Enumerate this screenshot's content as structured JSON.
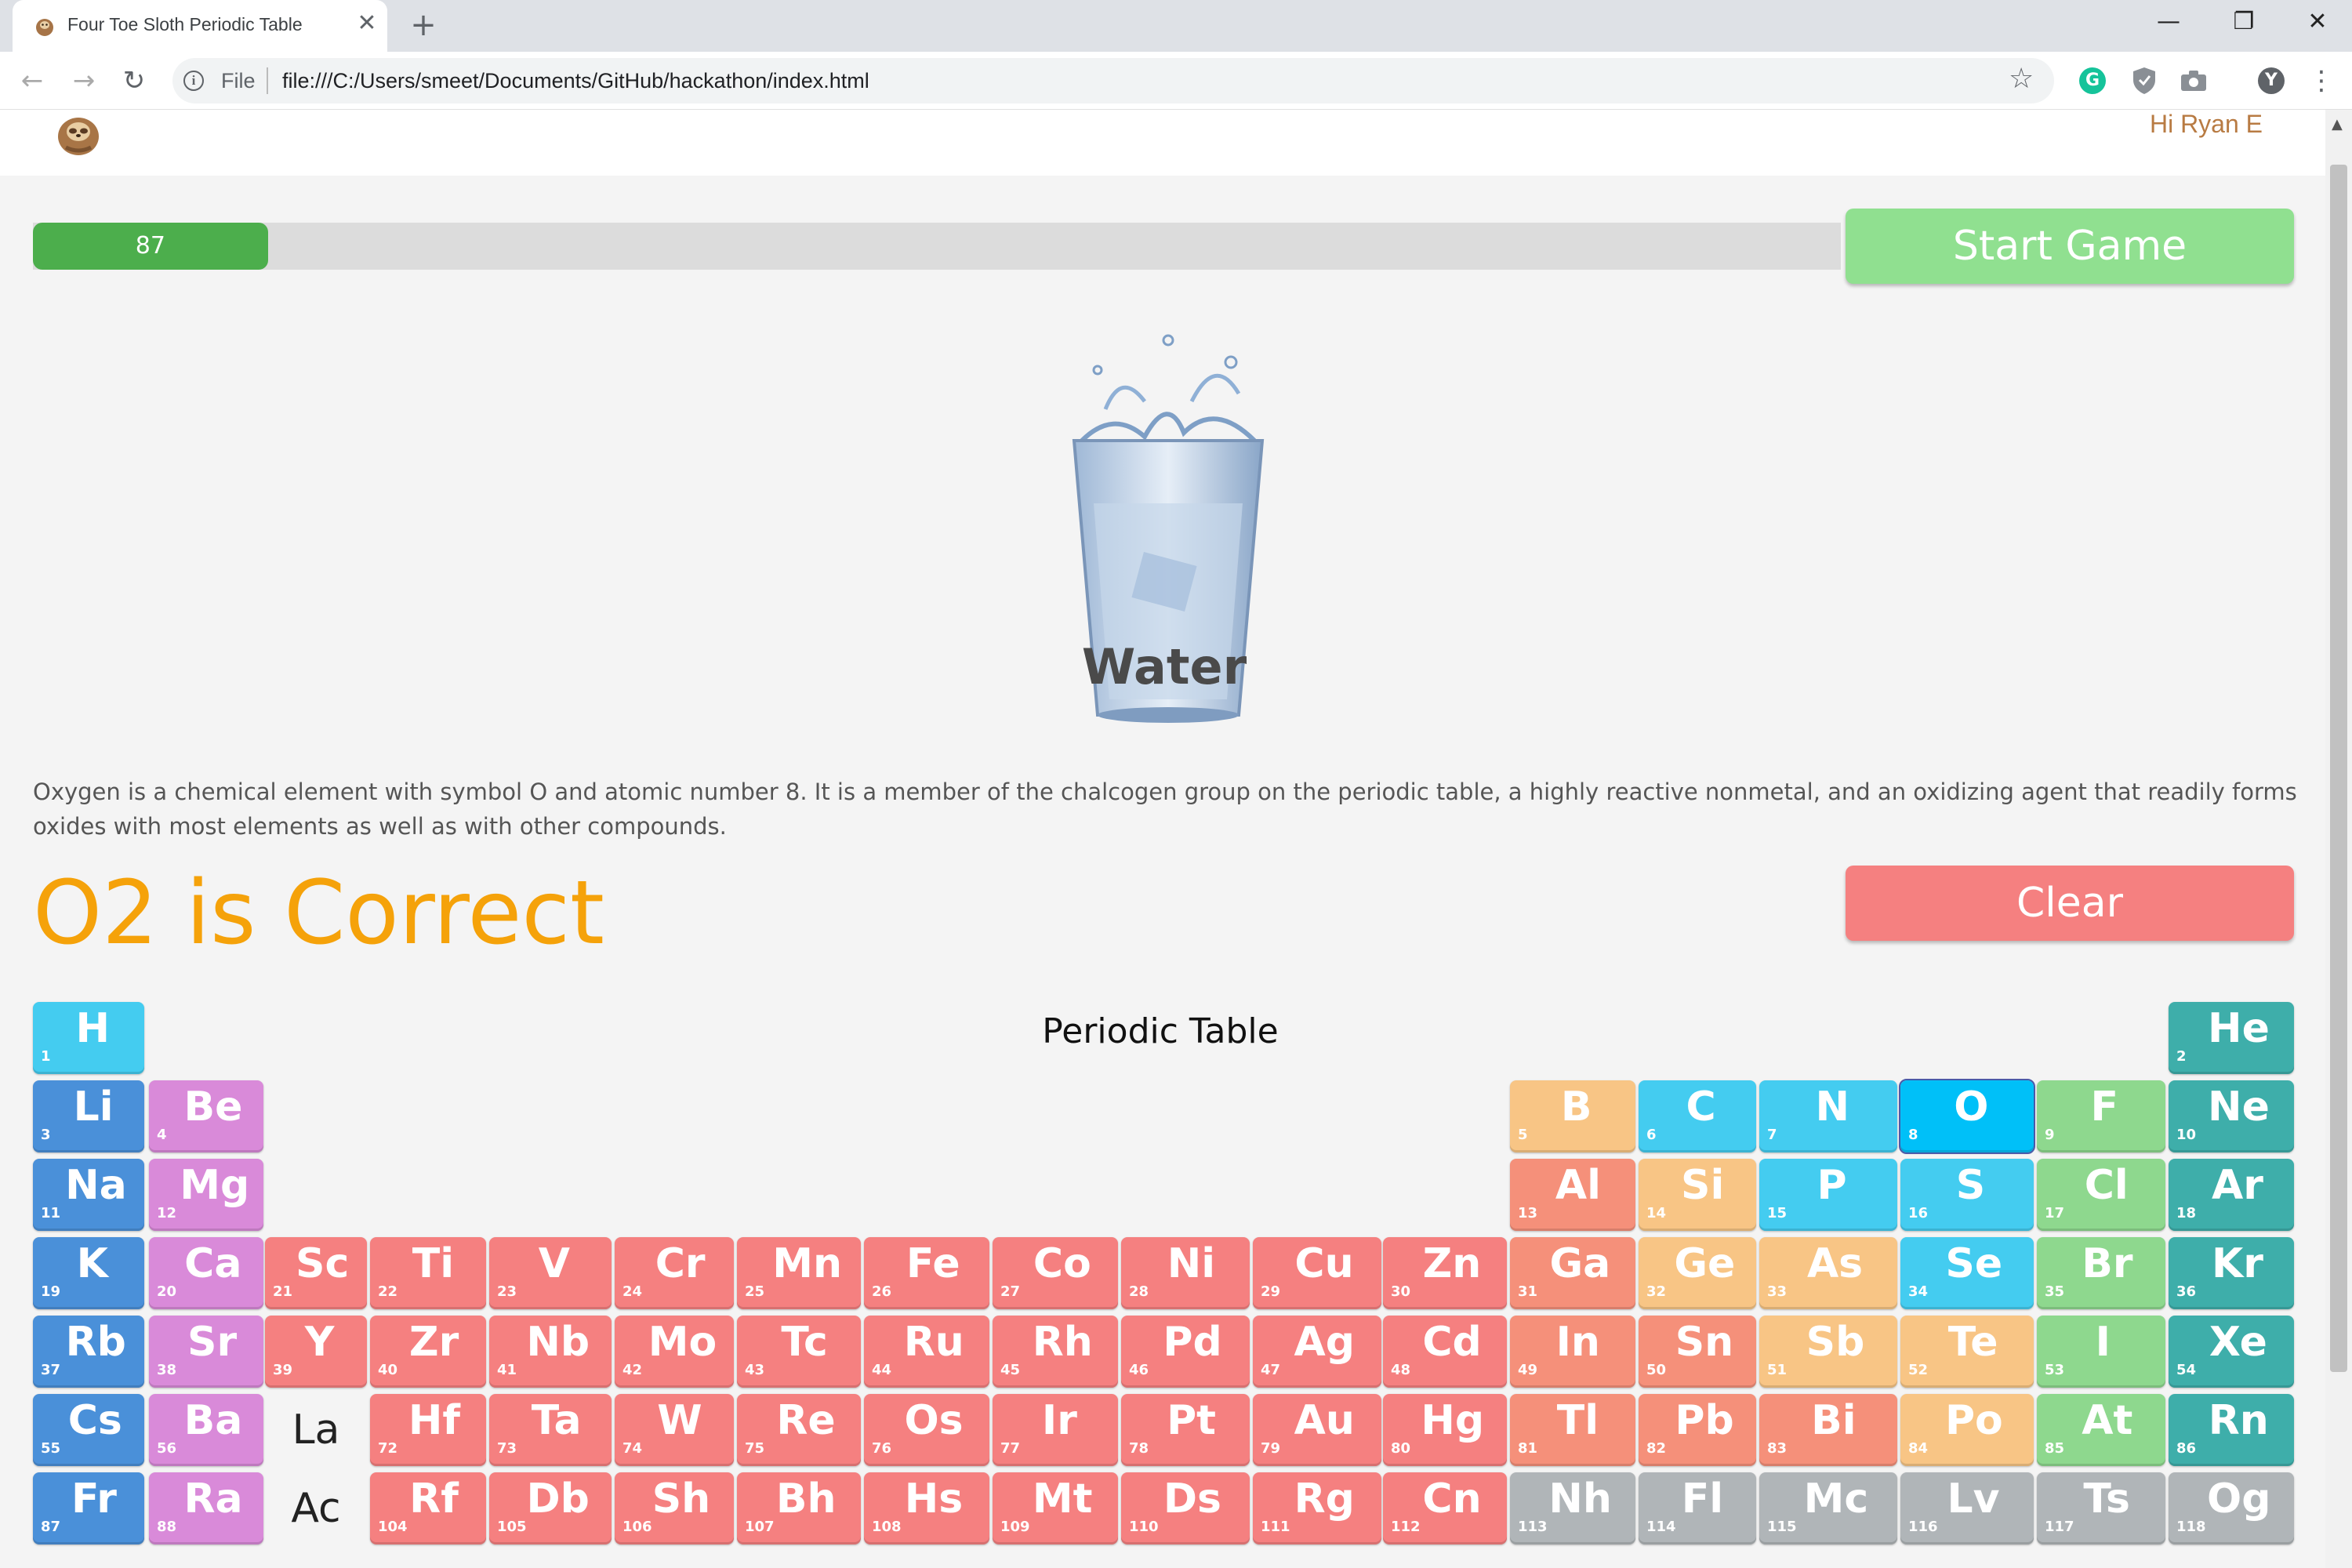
{
  "browser": {
    "tab_title": "Four Toe Sloth Periodic Table",
    "tab_close": "✕",
    "new_tab": "+",
    "minimize": "—",
    "restore": "❐",
    "close": "✕",
    "scheme_label": "File",
    "url": "file:///C:/Users/smeet/Documents/GitHub/hackathon/index.html",
    "back": "←",
    "forward": "→",
    "reload": "↻",
    "star": "☆",
    "menu": "⋮",
    "ext_grammarly": "G",
    "ext_profile": "Y"
  },
  "header": {
    "greeting": "Hi Ryan E"
  },
  "progress": {
    "value": 87,
    "label": "87",
    "fraction": 0.13
  },
  "buttons": {
    "start": "Start Game",
    "clear": "Clear"
  },
  "compound": {
    "name": "Water"
  },
  "description": "Oxygen is a chemical element with symbol O and atomic number 8. It is a member of the chalcogen group on the periodic table, a highly reactive nonmetal, and an oxidizing agent that readily forms oxides with most elements as well as with other compounds.",
  "result": "O2 is Correct",
  "table_title": "Periodic Table",
  "colors": {
    "alkali": "#4a90d9",
    "alkaline": "#d98ad9",
    "transition": "#f58080",
    "post_transition": "#f5907a",
    "metalloid": "#f8c585",
    "nonmetal": "#44ccf0",
    "selected": "#00c0f8",
    "halogen": "#8ed88e",
    "noble": "#3eaeaa",
    "unknown": "#b0b5b8",
    "accent": "#f5a20a"
  },
  "elements": [
    {
      "n": "1",
      "s": "H",
      "r": 0,
      "c": 0,
      "g": "nonmetal"
    },
    {
      "n": "2",
      "s": "He",
      "r": 0,
      "c": 17,
      "g": "noble"
    },
    {
      "n": "3",
      "s": "Li",
      "r": 1,
      "c": 0,
      "g": "alkali"
    },
    {
      "n": "4",
      "s": "Be",
      "r": 1,
      "c": 1,
      "g": "alkaline"
    },
    {
      "n": "5",
      "s": "B",
      "r": 1,
      "c": 12,
      "g": "metalloid"
    },
    {
      "n": "6",
      "s": "C",
      "r": 1,
      "c": 13,
      "g": "nonmetal"
    },
    {
      "n": "7",
      "s": "N",
      "r": 1,
      "c": 14,
      "g": "nonmetal"
    },
    {
      "n": "8",
      "s": "O",
      "r": 1,
      "c": 15,
      "g": "selected",
      "sel": true
    },
    {
      "n": "9",
      "s": "F",
      "r": 1,
      "c": 16,
      "g": "halogen"
    },
    {
      "n": "10",
      "s": "Ne",
      "r": 1,
      "c": 17,
      "g": "noble"
    },
    {
      "n": "11",
      "s": "Na",
      "r": 2,
      "c": 0,
      "g": "alkali"
    },
    {
      "n": "12",
      "s": "Mg",
      "r": 2,
      "c": 1,
      "g": "alkaline"
    },
    {
      "n": "13",
      "s": "Al",
      "r": 2,
      "c": 12,
      "g": "post_transition"
    },
    {
      "n": "14",
      "s": "Si",
      "r": 2,
      "c": 13,
      "g": "metalloid"
    },
    {
      "n": "15",
      "s": "P",
      "r": 2,
      "c": 14,
      "g": "nonmetal"
    },
    {
      "n": "16",
      "s": "S",
      "r": 2,
      "c": 15,
      "g": "nonmetal"
    },
    {
      "n": "17",
      "s": "Cl",
      "r": 2,
      "c": 16,
      "g": "halogen"
    },
    {
      "n": "18",
      "s": "Ar",
      "r": 2,
      "c": 17,
      "g": "noble"
    },
    {
      "n": "19",
      "s": "K",
      "r": 3,
      "c": 0,
      "g": "alkali"
    },
    {
      "n": "20",
      "s": "Ca",
      "r": 3,
      "c": 1,
      "g": "alkaline"
    },
    {
      "n": "21",
      "s": "Sc",
      "r": 3,
      "c": 2,
      "g": "transition"
    },
    {
      "n": "22",
      "s": "Ti",
      "r": 3,
      "c": 3,
      "g": "transition"
    },
    {
      "n": "23",
      "s": "V",
      "r": 3,
      "c": 4,
      "g": "transition"
    },
    {
      "n": "24",
      "s": "Cr",
      "r": 3,
      "c": 5,
      "g": "transition"
    },
    {
      "n": "25",
      "s": "Mn",
      "r": 3,
      "c": 6,
      "g": "transition"
    },
    {
      "n": "26",
      "s": "Fe",
      "r": 3,
      "c": 7,
      "g": "transition"
    },
    {
      "n": "27",
      "s": "Co",
      "r": 3,
      "c": 8,
      "g": "transition"
    },
    {
      "n": "28",
      "s": "Ni",
      "r": 3,
      "c": 9,
      "g": "transition"
    },
    {
      "n": "29",
      "s": "Cu",
      "r": 3,
      "c": 10,
      "g": "transition"
    },
    {
      "n": "30",
      "s": "Zn",
      "r": 3,
      "c": 11,
      "g": "transition"
    },
    {
      "n": "31",
      "s": "Ga",
      "r": 3,
      "c": 12,
      "g": "post_transition"
    },
    {
      "n": "32",
      "s": "Ge",
      "r": 3,
      "c": 13,
      "g": "metalloid"
    },
    {
      "n": "33",
      "s": "As",
      "r": 3,
      "c": 14,
      "g": "metalloid"
    },
    {
      "n": "34",
      "s": "Se",
      "r": 3,
      "c": 15,
      "g": "nonmetal"
    },
    {
      "n": "35",
      "s": "Br",
      "r": 3,
      "c": 16,
      "g": "halogen"
    },
    {
      "n": "36",
      "s": "Kr",
      "r": 3,
      "c": 17,
      "g": "noble"
    },
    {
      "n": "37",
      "s": "Rb",
      "r": 4,
      "c": 0,
      "g": "alkali"
    },
    {
      "n": "38",
      "s": "Sr",
      "r": 4,
      "c": 1,
      "g": "alkaline"
    },
    {
      "n": "39",
      "s": "Y",
      "r": 4,
      "c": 2,
      "g": "transition"
    },
    {
      "n": "40",
      "s": "Zr",
      "r": 4,
      "c": 3,
      "g": "transition"
    },
    {
      "n": "41",
      "s": "Nb",
      "r": 4,
      "c": 4,
      "g": "transition"
    },
    {
      "n": "42",
      "s": "Mo",
      "r": 4,
      "c": 5,
      "g": "transition"
    },
    {
      "n": "43",
      "s": "Tc",
      "r": 4,
      "c": 6,
      "g": "transition"
    },
    {
      "n": "44",
      "s": "Ru",
      "r": 4,
      "c": 7,
      "g": "transition"
    },
    {
      "n": "45",
      "s": "Rh",
      "r": 4,
      "c": 8,
      "g": "transition"
    },
    {
      "n": "46",
      "s": "Pd",
      "r": 4,
      "c": 9,
      "g": "transition"
    },
    {
      "n": "47",
      "s": "Ag",
      "r": 4,
      "c": 10,
      "g": "transition"
    },
    {
      "n": "48",
      "s": "Cd",
      "r": 4,
      "c": 11,
      "g": "transition"
    },
    {
      "n": "49",
      "s": "In",
      "r": 4,
      "c": 12,
      "g": "post_transition"
    },
    {
      "n": "50",
      "s": "Sn",
      "r": 4,
      "c": 13,
      "g": "post_transition"
    },
    {
      "n": "51",
      "s": "Sb",
      "r": 4,
      "c": 14,
      "g": "metalloid"
    },
    {
      "n": "52",
      "s": "Te",
      "r": 4,
      "c": 15,
      "g": "metalloid"
    },
    {
      "n": "53",
      "s": "I",
      "r": 4,
      "c": 16,
      "g": "halogen"
    },
    {
      "n": "54",
      "s": "Xe",
      "r": 4,
      "c": 17,
      "g": "noble"
    },
    {
      "n": "55",
      "s": "Cs",
      "r": 5,
      "c": 0,
      "g": "alkali"
    },
    {
      "n": "56",
      "s": "Ba",
      "r": 5,
      "c": 1,
      "g": "alkaline"
    },
    {
      "n": "72",
      "s": "Hf",
      "r": 5,
      "c": 3,
      "g": "transition"
    },
    {
      "n": "73",
      "s": "Ta",
      "r": 5,
      "c": 4,
      "g": "transition"
    },
    {
      "n": "74",
      "s": "W",
      "r": 5,
      "c": 5,
      "g": "transition"
    },
    {
      "n": "75",
      "s": "Re",
      "r": 5,
      "c": 6,
      "g": "transition"
    },
    {
      "n": "76",
      "s": "Os",
      "r": 5,
      "c": 7,
      "g": "transition"
    },
    {
      "n": "77",
      "s": "Ir",
      "r": 5,
      "c": 8,
      "g": "transition"
    },
    {
      "n": "78",
      "s": "Pt",
      "r": 5,
      "c": 9,
      "g": "transition"
    },
    {
      "n": "79",
      "s": "Au",
      "r": 5,
      "c": 10,
      "g": "transition"
    },
    {
      "n": "80",
      "s": "Hg",
      "r": 5,
      "c": 11,
      "g": "transition"
    },
    {
      "n": "81",
      "s": "Tl",
      "r": 5,
      "c": 12,
      "g": "post_transition"
    },
    {
      "n": "82",
      "s": "Pb",
      "r": 5,
      "c": 13,
      "g": "post_transition"
    },
    {
      "n": "83",
      "s": "Bi",
      "r": 5,
      "c": 14,
      "g": "post_transition"
    },
    {
      "n": "84",
      "s": "Po",
      "r": 5,
      "c": 15,
      "g": "metalloid"
    },
    {
      "n": "85",
      "s": "At",
      "r": 5,
      "c": 16,
      "g": "halogen"
    },
    {
      "n": "86",
      "s": "Rn",
      "r": 5,
      "c": 17,
      "g": "noble"
    },
    {
      "n": "87",
      "s": "Fr",
      "r": 6,
      "c": 0,
      "g": "alkali"
    },
    {
      "n": "88",
      "s": "Ra",
      "r": 6,
      "c": 1,
      "g": "alkaline"
    },
    {
      "n": "104",
      "s": "Rf",
      "r": 6,
      "c": 3,
      "g": "transition"
    },
    {
      "n": "105",
      "s": "Db",
      "r": 6,
      "c": 4,
      "g": "transition"
    },
    {
      "n": "106",
      "s": "Sh",
      "r": 6,
      "c": 5,
      "g": "transition"
    },
    {
      "n": "107",
      "s": "Bh",
      "r": 6,
      "c": 6,
      "g": "transition"
    },
    {
      "n": "108",
      "s": "Hs",
      "r": 6,
      "c": 7,
      "g": "transition"
    },
    {
      "n": "109",
      "s": "Mt",
      "r": 6,
      "c": 8,
      "g": "transition"
    },
    {
      "n": "110",
      "s": "Ds",
      "r": 6,
      "c": 9,
      "g": "transition"
    },
    {
      "n": "111",
      "s": "Rg",
      "r": 6,
      "c": 10,
      "g": "transition"
    },
    {
      "n": "112",
      "s": "Cn",
      "r": 6,
      "c": 11,
      "g": "transition"
    },
    {
      "n": "113",
      "s": "Nh",
      "r": 6,
      "c": 12,
      "g": "unknown"
    },
    {
      "n": "114",
      "s": "Fl",
      "r": 6,
      "c": 13,
      "g": "unknown"
    },
    {
      "n": "115",
      "s": "Mc",
      "r": 6,
      "c": 14,
      "g": "unknown"
    },
    {
      "n": "116",
      "s": "Lv",
      "r": 6,
      "c": 15,
      "g": "unknown"
    },
    {
      "n": "117",
      "s": "Ts",
      "r": 6,
      "c": 16,
      "g": "unknown"
    },
    {
      "n": "118",
      "s": "Og",
      "r": 6,
      "c": 17,
      "g": "unknown"
    }
  ],
  "placeholders": [
    {
      "s": "La",
      "r": 5,
      "c": 2
    },
    {
      "s": "Ac",
      "r": 6,
      "c": 2
    }
  ]
}
